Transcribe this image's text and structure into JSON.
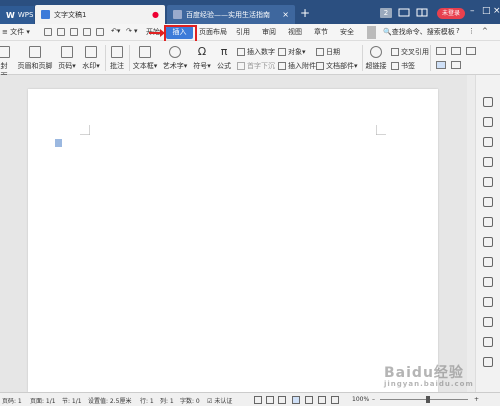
{
  "titlebar": {
    "wps_label": "WPS",
    "doc_tab": "文字文稿1",
    "web_tab": "百度经验——实用生活指南",
    "notif_count": "2",
    "login_label": "未登录",
    "colors": {
      "bar": "#2b4f80",
      "accent": "#3d7bd9",
      "login": "#e8404e"
    }
  },
  "menubar": {
    "file": "文件",
    "tabs": [
      "开始",
      "插入",
      "页面布局",
      "引用",
      "审阅",
      "视图",
      "章节",
      "安全"
    ],
    "active_tab": "插入",
    "search": "查找命令、搜索模板"
  },
  "ribbon": {
    "items": {
      "cover": "封面页",
      "header_footer": "页眉和页脚",
      "page_number": "页码",
      "watermark": "水印",
      "comment": "批注",
      "textbox": "文本框",
      "wordart": "艺术字",
      "symbol": "符号",
      "formula": "公式",
      "insert_number": "插入数字",
      "object": "对象",
      "date": "日期",
      "first_drop": "首字下沉",
      "attachment": "插入附件",
      "doc_parts": "文档部件",
      "hyperlink": "超链接",
      "crossref": "交叉引用",
      "bookmark": "书签"
    }
  },
  "statusbar": {
    "page": "页码: 1",
    "pages": "页面: 1/1",
    "section": "节: 1/1",
    "setting": "设置值: 2.5厘米",
    "row": "行: 1",
    "col": "列: 1",
    "wordcount": "字数: 0",
    "spell": "未认证",
    "zoom": "100%",
    "zoom_fraction": 0.5
  },
  "watermark": {
    "brand": "Baidu经验",
    "url": "jingyan.baidu.com"
  }
}
